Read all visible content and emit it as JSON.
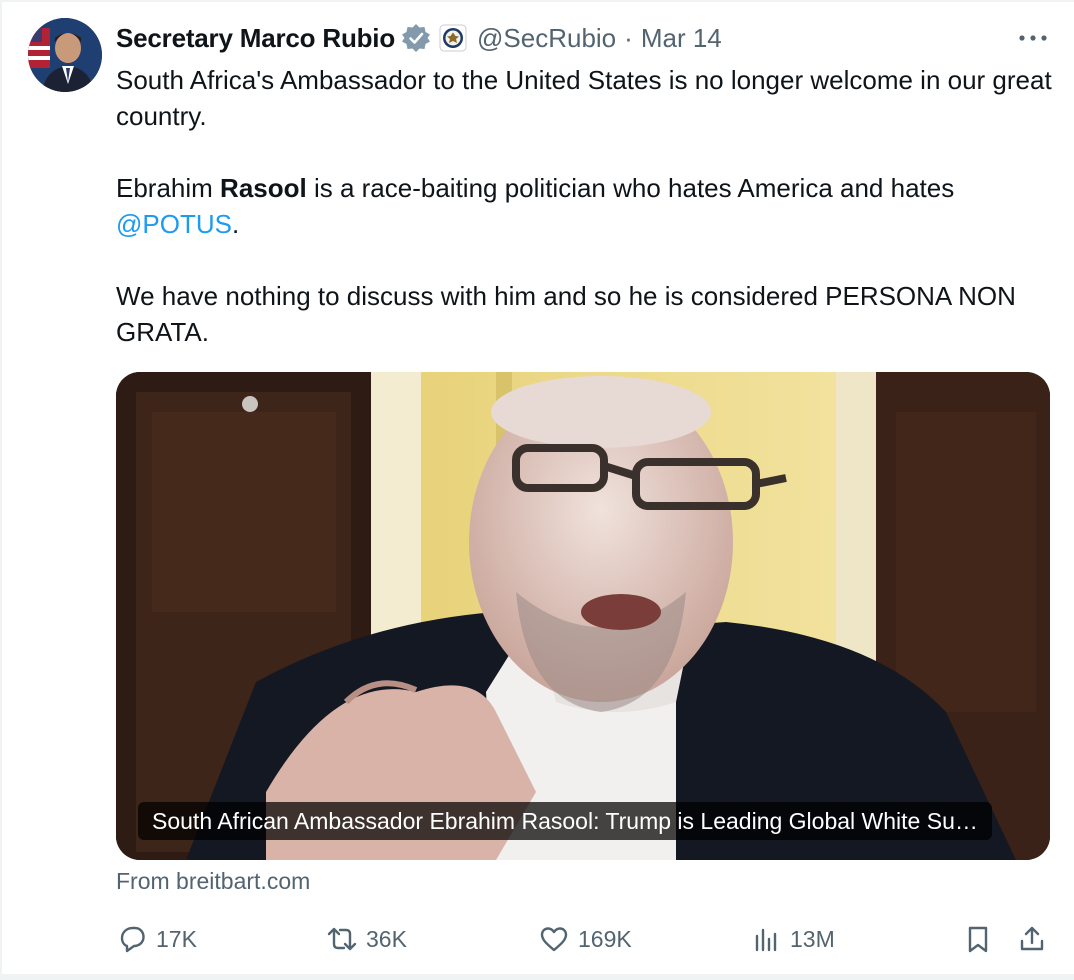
{
  "author": {
    "display_name": "Secretary Marco Rubio",
    "handle": "@SecRubio",
    "separator": "·",
    "date": "Mar 14",
    "verified_badge": "verified-check-icon",
    "affiliation_badge": "state-department-seal-icon"
  },
  "tweet": {
    "paragraph1": "South Africa's Ambassador to the United States is no longer welcome in our great country.",
    "p2_before": "Ebrahim ",
    "p2_bold": "Rasool",
    "p2_after": " is a race-baiting politician who hates America and hates ",
    "p2_mention": "@POTUS",
    "p2_end": ".",
    "paragraph3": "We have nothing to discuss with him and so he is considered PERSONA NON GRATA."
  },
  "media": {
    "caption": "South African Ambassador Ebrahim Rasool: Trump is Leading Global White Su…",
    "source": "From breitbart.com"
  },
  "actions": {
    "replies": "17K",
    "reposts": "36K",
    "likes": "169K",
    "views": "13M"
  },
  "colors": {
    "text": "#0f1419",
    "secondary": "#536471",
    "accent": "#1d9bf0"
  }
}
